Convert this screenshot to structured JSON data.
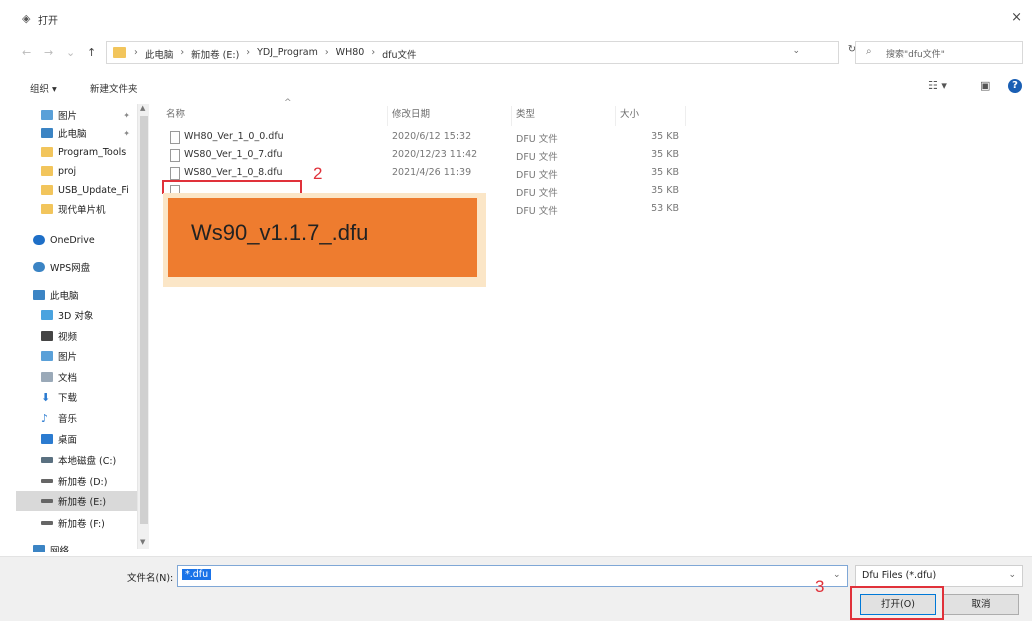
{
  "window": {
    "title": "打开",
    "close_glyph": "×"
  },
  "address": {
    "crumbs": [
      "此电脑",
      "新加卷 (E:)",
      "YDJ_Program",
      "WH80",
      "dfu文件"
    ],
    "search_placeholder": "搜索\"dfu文件\""
  },
  "toolbar": {
    "organize": "组织 ▾",
    "new_folder": "新建文件夹"
  },
  "sidebar": {
    "items": [
      {
        "label": "图片",
        "color": "#5aa0d8"
      },
      {
        "label": "此电脑",
        "color": "#3b84c4"
      },
      {
        "label": "Program_Tools",
        "color": "#f2c55c"
      },
      {
        "label": "proj",
        "color": "#f2c55c"
      },
      {
        "label": "USB_Update_Fi",
        "color": "#f2c55c"
      },
      {
        "label": "现代单片机",
        "color": "#f2c55c"
      },
      {
        "label": "OneDrive",
        "color": "#1e6fc7"
      },
      {
        "label": "WPS网盘",
        "color": "#3b84c4"
      },
      {
        "label": "此电脑",
        "color": "#3b84c4"
      },
      {
        "label": "3D 对象",
        "color": "#4aa3df"
      },
      {
        "label": "视频",
        "color": "#444444"
      },
      {
        "label": "图片",
        "color": "#5aa0d8"
      },
      {
        "label": "文档",
        "color": "#9aa9b8"
      },
      {
        "label": "下载",
        "color": "#2b7bd0"
      },
      {
        "label": "音乐",
        "color": "#2b7bd0"
      },
      {
        "label": "桌面",
        "color": "#2b7bd0"
      },
      {
        "label": "本地磁盘 (C:)",
        "color": "#5a7080"
      },
      {
        "label": "新加卷 (D:)",
        "color": "#666666"
      },
      {
        "label": "新加卷 (E:)",
        "color": "#666666"
      },
      {
        "label": "新加卷 (F:)",
        "color": "#666666"
      },
      {
        "label": "网络",
        "color": "#3b84c4"
      }
    ]
  },
  "columns": {
    "name": "名称",
    "date": "修改日期",
    "type": "类型",
    "size": "大小"
  },
  "files": [
    {
      "name": "WH80_Ver_1_0_0.dfu",
      "date": "2020/6/12 15:32",
      "type": "DFU 文件",
      "size": "35 KB"
    },
    {
      "name": "WS80_Ver_1_0_7.dfu",
      "date": "2020/12/23 11:42",
      "type": "DFU 文件",
      "size": "35 KB"
    },
    {
      "name": "WS80_Ver_1_0_8.dfu",
      "date": "2021/4/26 11:39",
      "type": "DFU 文件",
      "size": "35 KB"
    },
    {
      "name": "",
      "date": "",
      "type": "DFU 文件",
      "size": "35 KB"
    },
    {
      "name": "",
      "date": "",
      "type": "DFU 文件",
      "size": "53 KB"
    }
  ],
  "callout": {
    "text": "Ws90_v1.1.7_.dfu"
  },
  "annotations": {
    "step2": "2",
    "step3": "3"
  },
  "footer": {
    "filename_label": "文件名(N):",
    "filename_value": "*.dfu",
    "filter": "Dfu Files (*.dfu)",
    "open_button": "打开(O)",
    "cancel_button": "取消"
  },
  "colors": {
    "annotation_red": "#e0313a",
    "callout_orange": "#ee7c2f",
    "selection_blue": "#1a73e8"
  }
}
